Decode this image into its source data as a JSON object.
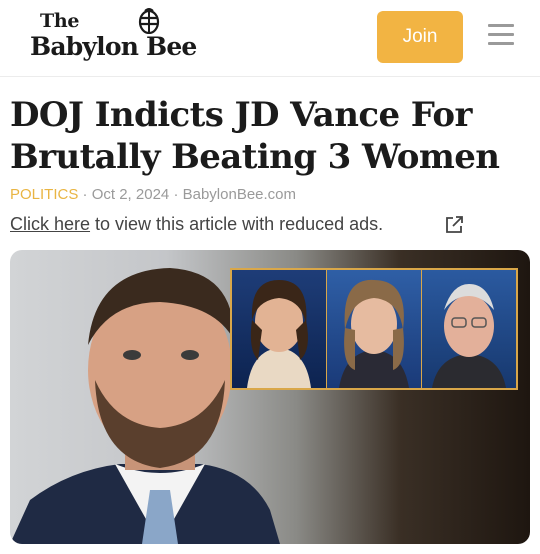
{
  "header": {
    "logo_the": "The",
    "logo_name": "Babylon Bee",
    "join_label": "Join"
  },
  "article": {
    "title": "DOJ Indicts JD Vance For Brutally Beating 3 Women",
    "category": "POLITICS",
    "separator": "·",
    "date": "Oct 2, 2024",
    "source": "BabylonBee.com",
    "ad_link": "Click here",
    "ad_text": " to view this article with reduced ads."
  },
  "colors": {
    "brand_gold": "#f2b443",
    "category": "#e9b543",
    "text_dark": "#1b1b1b",
    "meta_gray": "#9a9a9a"
  },
  "icons": {
    "logo": "bee-icon",
    "menu": "hamburger-menu-icon",
    "external": "external-link-icon"
  }
}
